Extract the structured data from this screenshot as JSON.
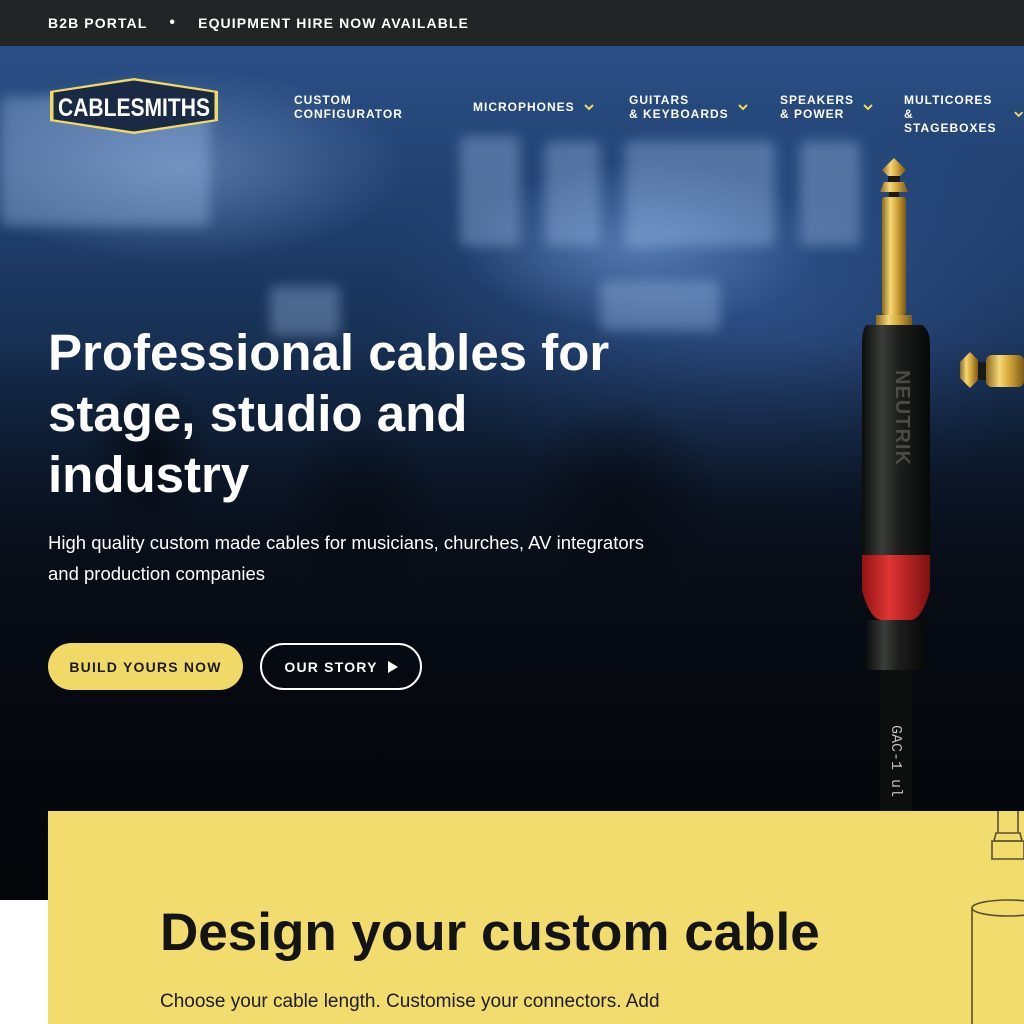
{
  "topbar": {
    "b2b": "B2B PORTAL",
    "separator": "•",
    "hire": "EQUIPMENT HIRE NOW AVAILABLE"
  },
  "header": {
    "logo_text": "CABLESMITHS",
    "nav": [
      {
        "line1": "CUSTOM",
        "line2": "CONFIGURATOR",
        "has_dropdown": false
      },
      {
        "line1": "MICROPHONES",
        "line2": "",
        "has_dropdown": true
      },
      {
        "line1": "GUITARS",
        "line2": "& KEYBOARDS",
        "has_dropdown": true
      },
      {
        "line1": "SPEAKERS",
        "line2": "& POWER",
        "has_dropdown": true
      },
      {
        "line1": "MULTICORES",
        "line2": "& STAGEBOXES",
        "has_dropdown": true
      }
    ]
  },
  "hero": {
    "title_line1": "Professional cables for",
    "title_line2": "stage, studio and",
    "title_line3": "industry",
    "subtitle_line1": "High quality custom made cables for musicians, churches, AV integrators",
    "subtitle_line2": "and production companies",
    "primary_cta": "BUILD YOURS NOW",
    "secondary_cta": "OUR STORY",
    "jack_brand": "NEUTRIK",
    "cable_print": "GAC-1 ul"
  },
  "design": {
    "title": "Design your custom cable",
    "text": "Choose your cable length. Customise your connectors. Add"
  },
  "colors": {
    "accent_yellow": "#f0d966",
    "topbar_bg": "#232426",
    "card_yellow": "#f1dc6d",
    "jack_red": "#d42a2a"
  },
  "icons": {
    "chevron": "chevron-down-icon",
    "play": "play-icon"
  }
}
